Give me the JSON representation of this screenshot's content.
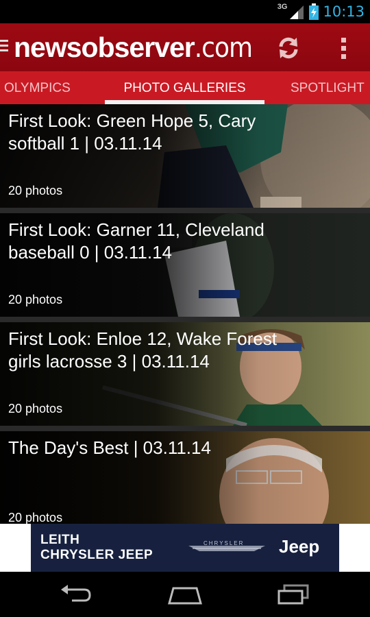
{
  "status_bar": {
    "network": "3G",
    "time": "10:13",
    "icons": [
      "signal-icon",
      "battery-charging-icon"
    ]
  },
  "header": {
    "logo_word": "newsobserver",
    "logo_domain": ".com",
    "actions": [
      "refresh-icon",
      "overflow-menu-icon"
    ]
  },
  "tabs": [
    {
      "label": "OLYMPICS",
      "selected": false
    },
    {
      "label": "PHOTO GALLERIES",
      "selected": true
    },
    {
      "label": "SPOTLIGHT",
      "selected": false
    }
  ],
  "galleries": [
    {
      "title": "First Look: Green Hope 5, Cary softball 1 | 03.11.14",
      "count": "20 photos"
    },
    {
      "title": "First Look: Garner 11, Cleveland baseball 0 | 03.11.14",
      "count": "20 photos"
    },
    {
      "title": "First Look: Enloe 12, Wake Forest girls lacrosse 3 | 03.11.14",
      "count": "20 photos"
    },
    {
      "title": "The Day's Best | 03.11.14",
      "count": "20 photos"
    }
  ],
  "ad": {
    "dealer_line1": "LEITH",
    "dealer_line2": "CHRYSLER JEEP",
    "brand_chrysler": "CHRYSLER",
    "brand_jeep": "Jeep"
  },
  "nav": [
    "back-icon",
    "home-icon",
    "recent-apps-icon"
  ],
  "colors": {
    "header": "#8b0610",
    "tab_bar": "#c91a24",
    "clock": "#33b5e5",
    "ad_background": "#17213f"
  }
}
